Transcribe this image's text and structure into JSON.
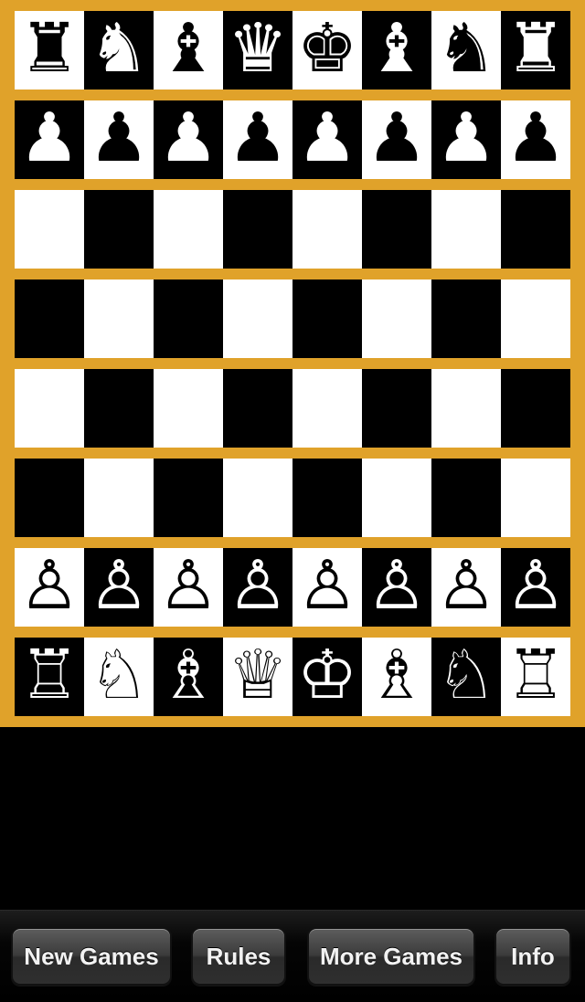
{
  "board": {
    "frame_color": "#e0a22a",
    "light_square_color": "#ffffff",
    "dark_square_color": "#000000",
    "ranks": [
      [
        {
          "glyph": "♜",
          "name": "black-rook-icon"
        },
        {
          "glyph": "♞",
          "name": "black-knight-icon"
        },
        {
          "glyph": "♝",
          "name": "black-bishop-icon"
        },
        {
          "glyph": "♛",
          "name": "black-queen-icon"
        },
        {
          "glyph": "♚",
          "name": "black-king-icon"
        },
        {
          "glyph": "♝",
          "name": "black-bishop-icon"
        },
        {
          "glyph": "♞",
          "name": "black-knight-icon"
        },
        {
          "glyph": "♜",
          "name": "black-rook-icon"
        }
      ],
      [
        {
          "glyph": "♟",
          "name": "black-pawn-icon"
        },
        {
          "glyph": "♟",
          "name": "black-pawn-icon"
        },
        {
          "glyph": "♟",
          "name": "black-pawn-icon"
        },
        {
          "glyph": "♟",
          "name": "black-pawn-icon"
        },
        {
          "glyph": "♟",
          "name": "black-pawn-icon"
        },
        {
          "glyph": "♟",
          "name": "black-pawn-icon"
        },
        {
          "glyph": "♟",
          "name": "black-pawn-icon"
        },
        {
          "glyph": "♟",
          "name": "black-pawn-icon"
        }
      ],
      [
        null,
        null,
        null,
        null,
        null,
        null,
        null,
        null
      ],
      [
        null,
        null,
        null,
        null,
        null,
        null,
        null,
        null
      ],
      [
        null,
        null,
        null,
        null,
        null,
        null,
        null,
        null
      ],
      [
        null,
        null,
        null,
        null,
        null,
        null,
        null,
        null
      ],
      [
        {
          "glyph": "♙",
          "name": "white-pawn-icon"
        },
        {
          "glyph": "♙",
          "name": "white-pawn-icon"
        },
        {
          "glyph": "♙",
          "name": "white-pawn-icon"
        },
        {
          "glyph": "♙",
          "name": "white-pawn-icon"
        },
        {
          "glyph": "♙",
          "name": "white-pawn-icon"
        },
        {
          "glyph": "♙",
          "name": "white-pawn-icon"
        },
        {
          "glyph": "♙",
          "name": "white-pawn-icon"
        },
        {
          "glyph": "♙",
          "name": "white-pawn-icon"
        }
      ],
      [
        {
          "glyph": "♖",
          "name": "white-rook-icon"
        },
        {
          "glyph": "♘",
          "name": "white-knight-icon"
        },
        {
          "glyph": "♗",
          "name": "white-bishop-icon"
        },
        {
          "glyph": "♕",
          "name": "white-queen-icon"
        },
        {
          "glyph": "♔",
          "name": "white-king-icon"
        },
        {
          "glyph": "♗",
          "name": "white-bishop-icon"
        },
        {
          "glyph": "♘",
          "name": "white-knight-icon"
        },
        {
          "glyph": "♖",
          "name": "white-rook-icon"
        }
      ]
    ]
  },
  "toolbar": {
    "new_games_label": "New Games",
    "rules_label": "Rules",
    "more_games_label": "More Games",
    "info_label": "Info"
  }
}
